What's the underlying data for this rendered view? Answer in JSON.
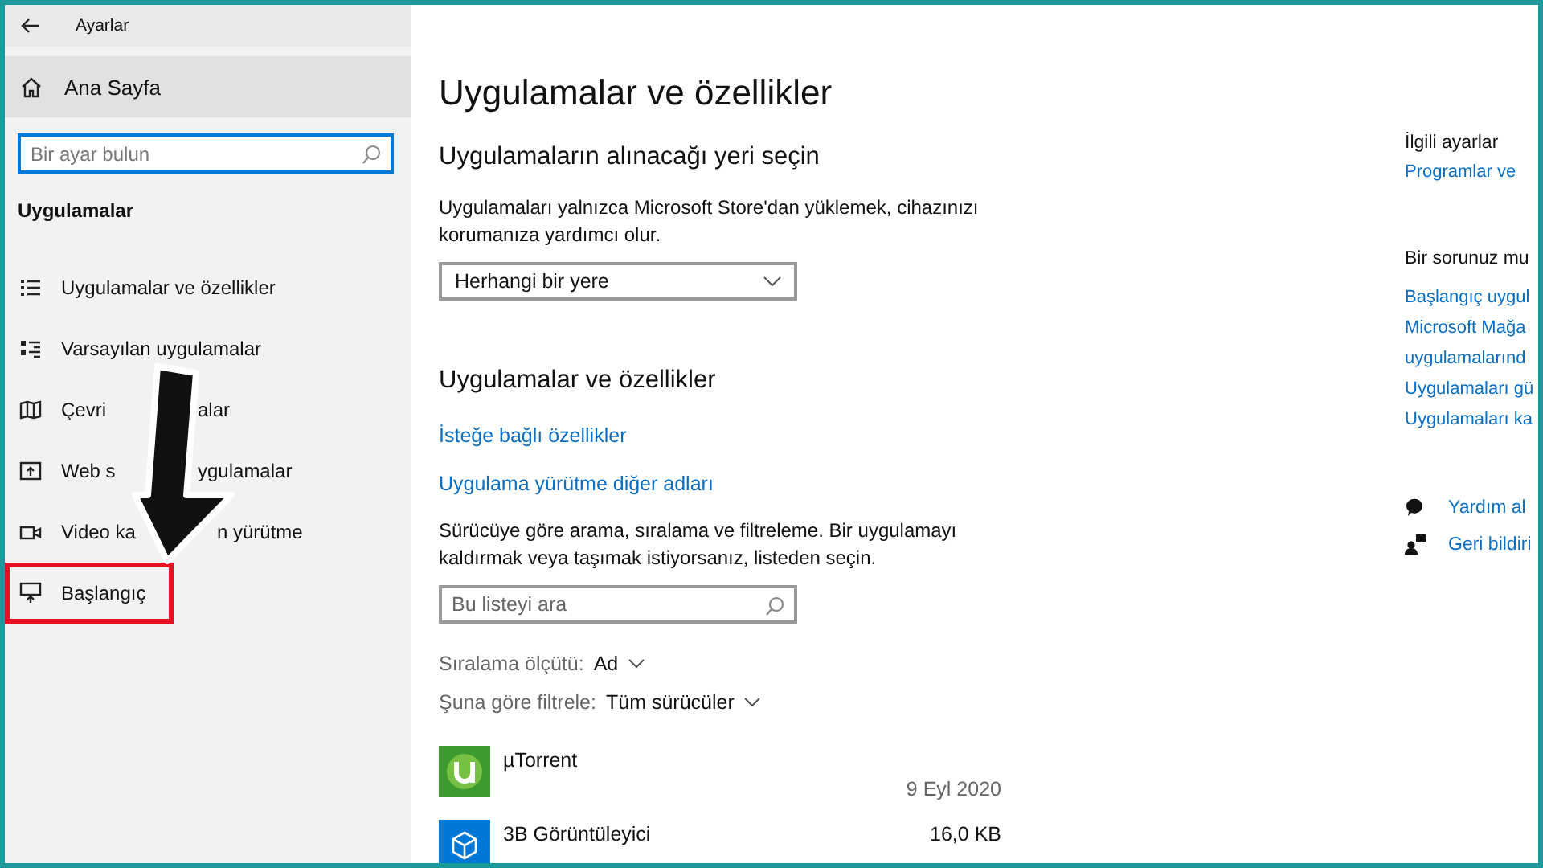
{
  "window": {
    "title": "Ayarlar"
  },
  "sidebar": {
    "home": "Ana Sayfa",
    "search": {
      "placeholder": "Bir ayar bulun"
    },
    "section": "Uygulamalar",
    "items": [
      {
        "kind": "list",
        "parts": [
          "Uygulamalar ve özellikler"
        ],
        "highlighted": false
      },
      {
        "kind": "defaults",
        "parts": [
          "Varsayılan uygulamalar"
        ],
        "highlighted": false
      },
      {
        "kind": "map",
        "parts": [
          "Çevri",
          "alar"
        ],
        "highlighted": false
      },
      {
        "kind": "web",
        "parts": [
          "Web s",
          "ygulamalar"
        ],
        "highlighted": false
      },
      {
        "kind": "video",
        "parts": [
          "Video ka",
          "n yürütme"
        ],
        "highlighted": false
      },
      {
        "kind": "startup",
        "parts": [
          "Başlangıç"
        ],
        "highlighted": true
      }
    ]
  },
  "main": {
    "title": "Uygulamalar ve özellikler",
    "source": {
      "heading": "Uygulamaların alınacağı yeri seçin",
      "description": "Uygulamaları yalnızca Microsoft Store'dan yüklemek, cihazınızı korumanıza yardımcı olur.",
      "dropdown": {
        "value": "Herhangi bir yere"
      }
    },
    "apps": {
      "heading": "Uygulamalar ve özellikler",
      "links": [
        "İsteğe bağlı özellikler",
        "Uygulama yürütme diğer adları"
      ],
      "description": "Sürücüye göre arama, sıralama ve filtreleme. Bir uygulamayı kaldırmak veya taşımak istiyorsanız, listeden seçin.",
      "search": {
        "placeholder": "Bu listeyi ara"
      },
      "sort": {
        "label": "Sıralama ölçütü:",
        "value": "Ad"
      },
      "filter": {
        "label": "Şuna göre filtrele:",
        "value": "Tüm sürücüler"
      },
      "items": [
        {
          "kind": "torrent",
          "name": "µTorrent",
          "date": "9 Eyl 2020"
        },
        {
          "kind": "cube",
          "name": "3B Görüntüleyici",
          "size": "16,0 KB"
        }
      ]
    }
  },
  "related": {
    "heading": "İlgili ayarlar",
    "links": [
      "Programlar ve"
    ]
  },
  "questions": {
    "heading": "Bir sorunuz mu",
    "links": [
      "Başlangıç uygul",
      "Microsoft Mağa",
      "uygulamalarınd",
      "Uygulamaları gü",
      "Uygulamaları ka"
    ]
  },
  "support": [
    {
      "kind": "help",
      "label": "Yardım al"
    },
    {
      "kind": "feedback",
      "label": "Geri bildiri"
    }
  ]
}
